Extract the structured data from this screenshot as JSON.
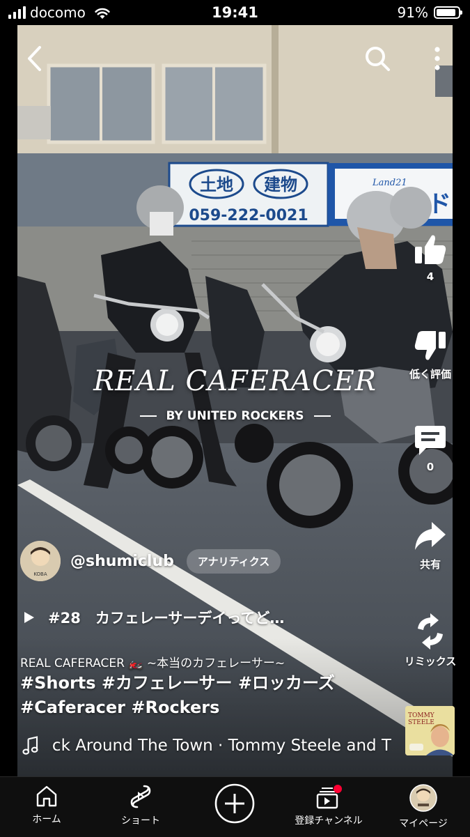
{
  "status_bar": {
    "carrier": "docomo",
    "time": "19:41",
    "battery": "91%",
    "battery_level": 0.91
  },
  "video": {
    "overlay_title": "REAL CAFERACER",
    "overlay_subtitle": "BY UNITED ROCKERS",
    "sign_left_text1": "土地",
    "sign_left_text2": "建物",
    "sign_phone": "059-222-0021",
    "sign_right_text": "ンド",
    "sign_logo": "Land21"
  },
  "top_bar": {
    "back_icon": "back-arrow-icon",
    "search_icon": "search-icon",
    "more_icon": "more-vertical-icon"
  },
  "actions": {
    "like_count": "4",
    "dislike_label": "低く評価",
    "comment_count": "0",
    "share_label": "共有",
    "remix_label": "リミックス"
  },
  "channel": {
    "avatar_text": "KOBA",
    "name": "@shumiclub",
    "analytics_label": "アナリティクス"
  },
  "linked_video": {
    "title": "#28　カフェレーサーデイってど…"
  },
  "description": {
    "line1": "REAL CAFERACER 🏍️ ~本当のカフェレーサー~",
    "tags_line1": "#Shorts #カフェレーサー #ロッカーズ",
    "tags_line2": "#Caferacer #Rockers"
  },
  "music": {
    "text": "ck Around The Town · Tommy Steele and T",
    "album_title_line1": "TOMMY",
    "album_title_line2": "STEELE"
  },
  "bottom_nav": {
    "items": [
      {
        "label": "ホーム",
        "icon": "home-icon"
      },
      {
        "label": "ショート",
        "icon": "shorts-icon"
      },
      {
        "label": "",
        "icon": "create-plus-icon"
      },
      {
        "label": "登録チャンネル",
        "icon": "subscriptions-icon"
      },
      {
        "label": "マイページ",
        "icon": "avatar"
      }
    ]
  },
  "colors": {
    "background": "#000000",
    "nav_background": "#0f0f0f",
    "notification_dot": "#ff0033"
  }
}
